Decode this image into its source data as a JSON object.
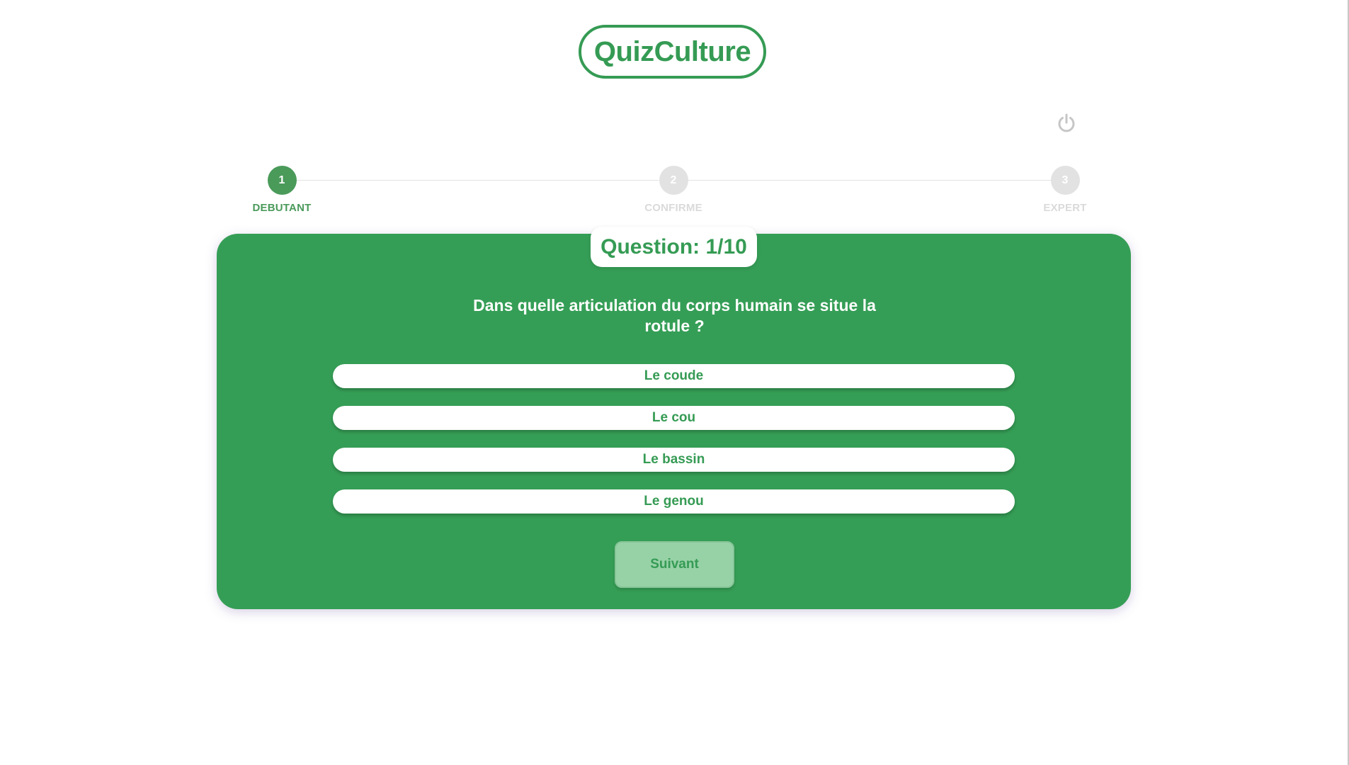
{
  "app": {
    "logo_text": "QuizCulture"
  },
  "header": {
    "power_icon": "power-icon"
  },
  "stepper": {
    "steps": [
      {
        "number": "1",
        "label": "DEBUTANT",
        "state": "active"
      },
      {
        "number": "2",
        "label": "CONFIRME",
        "state": "inactive"
      },
      {
        "number": "3",
        "label": "EXPERT",
        "state": "inactive"
      }
    ]
  },
  "quiz": {
    "counter": "Question: 1/10",
    "question": "Dans quelle articulation du corps humain se situe la rotule ?",
    "answers": [
      "Le coude",
      "Le cou",
      "Le bassin",
      "Le genou"
    ],
    "next_label": "Suivant"
  },
  "colors": {
    "primary_green": "#359e56",
    "step_active": "#4a9a5a",
    "step_inactive": "#e2e2e2",
    "next_button_bg": "#97d2a7"
  }
}
